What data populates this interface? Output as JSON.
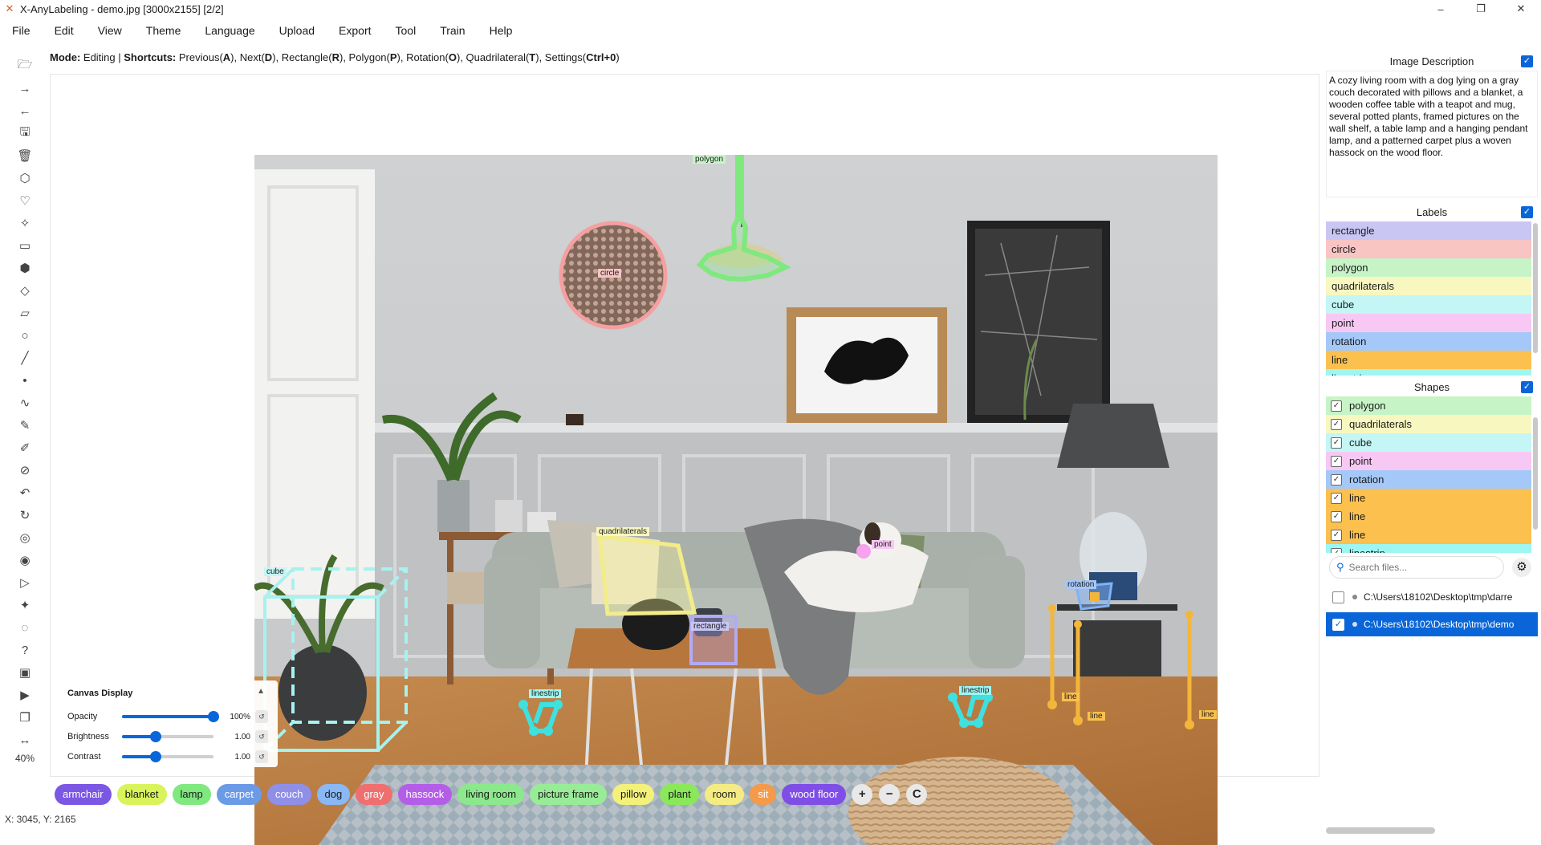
{
  "window": {
    "title": "X-AnyLabeling - demo.jpg [3000x2155] [2/2]",
    "minimize": "–",
    "maximize": "❐",
    "close": "✕"
  },
  "menu": [
    "File",
    "Edit",
    "View",
    "Theme",
    "Language",
    "Upload",
    "Export",
    "Tool",
    "Train",
    "Help"
  ],
  "modebar": {
    "mode_label": "Mode:",
    "mode_value": " Editing | ",
    "shortcuts_label": "Shortcuts:",
    "s1": " Previous(",
    "k1": "A",
    "s2": "), Next(",
    "k2": "D",
    "s3": "), Rectangle(",
    "k3": "R",
    "s4": "), Polygon(",
    "k4": "P",
    "s5": "), Rotation(",
    "k5": "O",
    "s6": "), Quadrilateral(",
    "k6": "T",
    "s7": "), Settings(",
    "k7": "Ctrl+0",
    "s8": ")"
  },
  "toolbar": {
    "zoom": "40%",
    "icons": [
      "open-folder-icon",
      "next-image-icon",
      "prev-image-icon",
      "save-icon",
      "delete-icon",
      "polygon-icon",
      "heart-icon",
      "magic-wand-icon",
      "rectangle-icon",
      "cube-icon",
      "diamond-icon",
      "quadrilateral-icon",
      "circle-icon",
      "line-icon",
      "point-icon",
      "linestrip-icon",
      "brush-icon",
      "edit-icon",
      "cancel-icon",
      "undo-icon",
      "redo-icon",
      "ai-icon",
      "eye-icon",
      "play-icon",
      "sparkle-icon",
      "chat-icon",
      "help-icon",
      "image-icon",
      "video-icon",
      "copy-icon",
      "fit-width-icon"
    ]
  },
  "annotations": {
    "polygon": "polygon",
    "circle": "circle",
    "quadrilaterals": "quadrilaterals",
    "point": "point",
    "rectangle": "rectangle",
    "cube": "cube",
    "rotation": "rotation",
    "linestrip": "linestrip",
    "line": "line"
  },
  "canvas_display": {
    "title": "Canvas Display",
    "opacity_label": "Opacity",
    "opacity_value": "100%",
    "opacity_level": 1.0,
    "brightness_label": "Brightness",
    "brightness_value": "1.00",
    "brightness_level": 0.37,
    "contrast_label": "Contrast",
    "contrast_value": "1.00",
    "contrast_level": 0.37
  },
  "chips": [
    {
      "label": "armchair",
      "color": "#7b57e4",
      "dark": true
    },
    {
      "label": "blanket",
      "color": "#d8f45a",
      "dark": false
    },
    {
      "label": "lamp",
      "color": "#7fe87f",
      "dark": false
    },
    {
      "label": "carpet",
      "color": "#6b9ae6",
      "dark": true
    },
    {
      "label": "couch",
      "color": "#8f8fe8",
      "dark": true
    },
    {
      "label": "dog",
      "color": "#8ab8f4",
      "dark": false
    },
    {
      "label": "gray",
      "color": "#ef6f6f",
      "dark": true
    },
    {
      "label": "hassock",
      "color": "#b45ee8",
      "dark": true
    },
    {
      "label": "living room",
      "color": "#8ce88c",
      "dark": false
    },
    {
      "label": "picture frame",
      "color": "#98ec98",
      "dark": false
    },
    {
      "label": "pillow",
      "color": "#f4f17a",
      "dark": false
    },
    {
      "label": "plant",
      "color": "#8be85a",
      "dark": false
    },
    {
      "label": "room",
      "color": "#f4ec82",
      "dark": false
    },
    {
      "label": "sit",
      "color": "#f49a4a",
      "dark": true
    },
    {
      "label": "wood floor",
      "color": "#7f4ee6",
      "dark": true
    }
  ],
  "chip_actions": {
    "add": "+",
    "remove": "−",
    "clear": "C"
  },
  "status": "X: 3045, Y: 2165",
  "image_description": {
    "title": "Image Description",
    "text": "A cozy living room with a dog lying on a gray couch decorated with pillows and a blanket, a wooden coffee table with a teapot and mug, several potted plants, framed pictures on the wall shelf, a table lamp and a hanging pendant lamp, and a patterned carpet plus a woven hassock on the wood floor."
  },
  "labels": {
    "title": "Labels",
    "items": [
      {
        "label": "rectangle",
        "color": "#c9c6f4"
      },
      {
        "label": "circle",
        "color": "#f8c4c4"
      },
      {
        "label": "polygon",
        "color": "#c6f4c6"
      },
      {
        "label": "quadrilaterals",
        "color": "#f8f7c0"
      },
      {
        "label": "cube",
        "color": "#c4f6f6"
      },
      {
        "label": "point",
        "color": "#f8c8f4"
      },
      {
        "label": "rotation",
        "color": "#a4c8f8"
      },
      {
        "label": "line",
        "color": "#fbc04d"
      },
      {
        "label": "linestrip",
        "color": "#9ef6f2"
      }
    ]
  },
  "shapes": {
    "title": "Shapes",
    "items": [
      {
        "label": "polygon",
        "color": "#c6f4c6"
      },
      {
        "label": "quadrilaterals",
        "color": "#f8f7c0"
      },
      {
        "label": "cube",
        "color": "#c4f6f6"
      },
      {
        "label": "point",
        "color": "#f8c8f4"
      },
      {
        "label": "rotation",
        "color": "#a4c8f8"
      },
      {
        "label": "line",
        "color": "#fbc04d"
      },
      {
        "label": "line",
        "color": "#fbc04d"
      },
      {
        "label": "line",
        "color": "#fbc04d"
      },
      {
        "label": "linestrip",
        "color": "#9ef6f2"
      }
    ]
  },
  "files": {
    "search_placeholder": "Search files...",
    "items": [
      {
        "path": "C:\\Users\\18102\\Desktop\\tmp\\darre",
        "checked": false,
        "selected": false
      },
      {
        "path": "C:\\Users\\18102\\Desktop\\tmp\\demo",
        "checked": true,
        "selected": true
      }
    ]
  },
  "colors": {
    "accent": "#0a66d8"
  }
}
